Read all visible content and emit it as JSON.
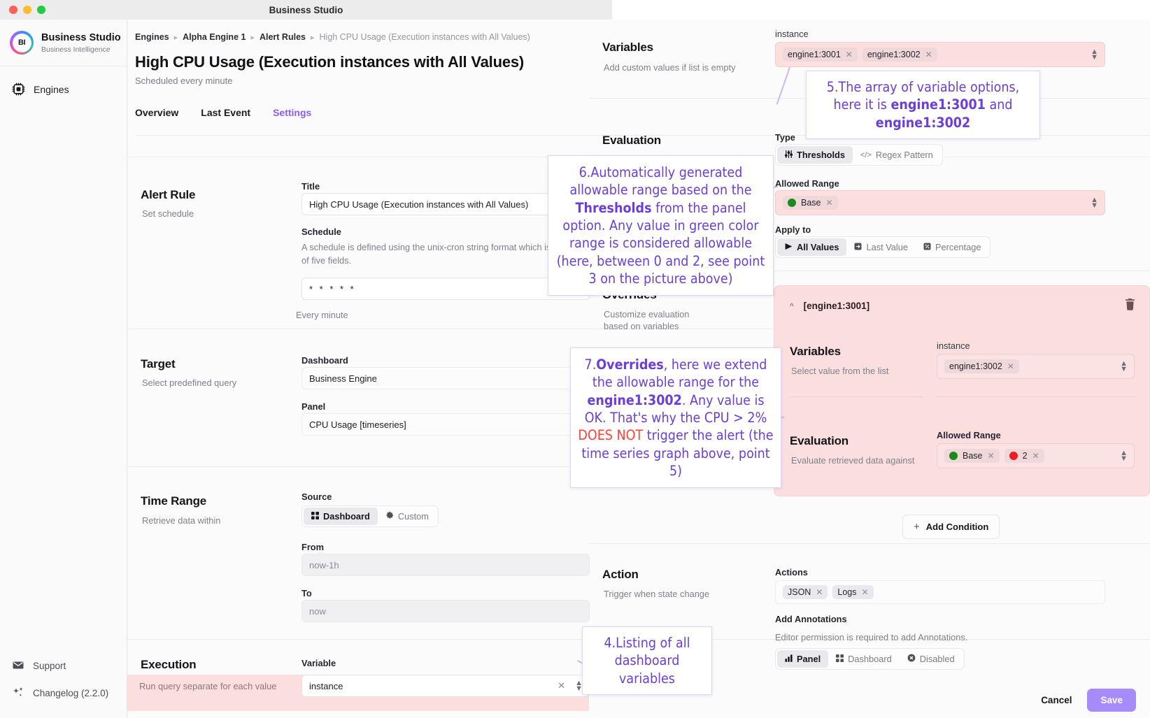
{
  "window": {
    "title": "Business Studio"
  },
  "sidebar": {
    "brand": {
      "logo_text": "BI",
      "name": "Business Studio",
      "sub": "Business Intelligence"
    },
    "items": [
      {
        "label": "Engines",
        "icon": "cpu-icon"
      }
    ],
    "bottom": [
      {
        "label": "Support",
        "icon": "mail-icon"
      },
      {
        "label": "Changelog (2.2.0)",
        "icon": "sparkles-icon"
      }
    ]
  },
  "breadcrumb": [
    "Engines",
    "Alpha Engine 1",
    "Alert Rules",
    "High CPU Usage (Execution instances with All Values)"
  ],
  "page": {
    "title": "High CPU Usage (Execution instances with All Values)",
    "subtitle": "Scheduled every minute"
  },
  "tabs": [
    {
      "label": "Overview",
      "active": false
    },
    {
      "label": "Last Event",
      "active": false
    },
    {
      "label": "Settings",
      "active": true
    }
  ],
  "sections": {
    "alert_rule": {
      "label": "Alert Rule",
      "desc": "Set schedule",
      "title_label": "Title",
      "title_value": "High CPU Usage (Execution instances with All Values)",
      "schedule_label": "Schedule",
      "schedule_help": "A schedule is defined using the unix-cron string format which is a set of five fields.",
      "schedule_value": "* * * * *",
      "schedule_hint": "Every minute"
    },
    "target": {
      "label": "Target",
      "desc": "Select predefined query",
      "dashboard_label": "Dashboard",
      "dashboard_value": "Business Engine",
      "panel_label": "Panel",
      "panel_value": "CPU Usage [timeseries]"
    },
    "time_range": {
      "label": "Time Range",
      "desc": "Retrieve data within",
      "source_label": "Source",
      "source_options": [
        {
          "label": "Dashboard",
          "icon": "grid-icon",
          "selected": true
        },
        {
          "label": "Custom",
          "icon": "gear-icon",
          "selected": false
        }
      ],
      "from_label": "From",
      "from_value": "now-1h",
      "to_label": "To",
      "to_value": "now"
    },
    "execution": {
      "label": "Execution",
      "desc": "Run query separate for each value",
      "variable_label": "Variable",
      "variable_value": "instance"
    },
    "variables": {
      "label": "Variables",
      "desc": "Add custom values if list is empty",
      "field_label": "instance",
      "values": [
        "engine1:3001",
        "engine1:3002"
      ]
    },
    "evaluation": {
      "label": "Evaluation",
      "desc": "Evaluate retrieved data against",
      "type_label": "Type",
      "type_options": [
        {
          "label": "Thresholds",
          "icon": "sliders-icon",
          "selected": true
        },
        {
          "label": "Regex Pattern",
          "icon": "code-icon",
          "selected": false
        }
      ],
      "allowed_range_label": "Allowed Range",
      "allowed_range": [
        {
          "label": "Base",
          "color": "#1a8a1a"
        }
      ],
      "apply_to_label": "Apply to",
      "apply_to_options": [
        {
          "label": "All Values",
          "icon": "send-icon",
          "selected": true
        },
        {
          "label": "Last Value",
          "icon": "last-value-icon",
          "selected": false
        },
        {
          "label": "Percentage",
          "icon": "percent-icon",
          "selected": false
        }
      ]
    },
    "overrides": {
      "label": "Overrides",
      "desc": "Customize evaluation based on variables",
      "card_title": "[engine1:3001]",
      "variables_label": "Variables",
      "variables_desc": "Select value from the list",
      "variables_field_label": "instance",
      "variables_values": [
        "engine1:3002"
      ],
      "evaluation_label": "Evaluation",
      "evaluation_desc": "Evaluate retrieved data against",
      "allowed_range_label": "Allowed Range",
      "allowed_range": [
        {
          "label": "Base",
          "color": "#1a8a1a"
        },
        {
          "label": "2",
          "color": "#f01c1c"
        }
      ],
      "add_condition_label": "Add Condition"
    },
    "action": {
      "label": "Action",
      "desc": "Trigger when state change",
      "actions_label": "Actions",
      "actions": [
        "JSON",
        "Logs"
      ],
      "annotations_label": "Add Annotations",
      "annotations_help": "Editor permission is required to add Annotations.",
      "annotation_options": [
        {
          "label": "Panel",
          "icon": "bar-chart-icon",
          "selected": true
        },
        {
          "label": "Dashboard",
          "icon": "grid-icon",
          "selected": false
        },
        {
          "label": "Disabled",
          "icon": "disabled-icon",
          "selected": false
        }
      ]
    }
  },
  "footer": {
    "cancel": "Cancel",
    "save": "Save"
  },
  "annotations": [
    {
      "id": 5,
      "html": "5.The array of variable options, here it is <b>engine1:3001</b> and <b>engine1:3002</b>",
      "text": "5.The array of variable options, here it is engine1:3001 and engine1:3002"
    },
    {
      "id": 6,
      "html": "6.Automatically generated allowable range based on the <b>Thresholds</b> from the panel option. Any value in green color range is considered allowable (here, between 0 and 2, see point 3 on the picture above)",
      "text": "6.Automatically generated allowable range based on the Thresholds from the panel option. Any value in green color range is considered allowable (here, between 0 and 2, see point 3 on the picture above)"
    },
    {
      "id": 7,
      "html": "7.<b>Overrides</b>, here we extend the allowable range for the <b>engine1:3002</b>. Any value is OK. That's why the CPU &gt; 2% <span class=\"red\">DOES NOT</span> trigger the alert (the time series graph above, point 5)",
      "text": "7.Overrides, here we extend the allowable range for the engine1:3002. Any value is OK. That's why the CPU > 2% DOES NOT trigger the alert (the time series graph above, point 5)"
    },
    {
      "id": 4,
      "html": "4.Listing of all dashboard variables",
      "text": "4.Listing of all dashboard variables"
    }
  ],
  "colors": {
    "accent": "#8b5cf6",
    "highlight": "#fbdede",
    "green": "#1a8a1a",
    "red": "#f01c1c"
  }
}
